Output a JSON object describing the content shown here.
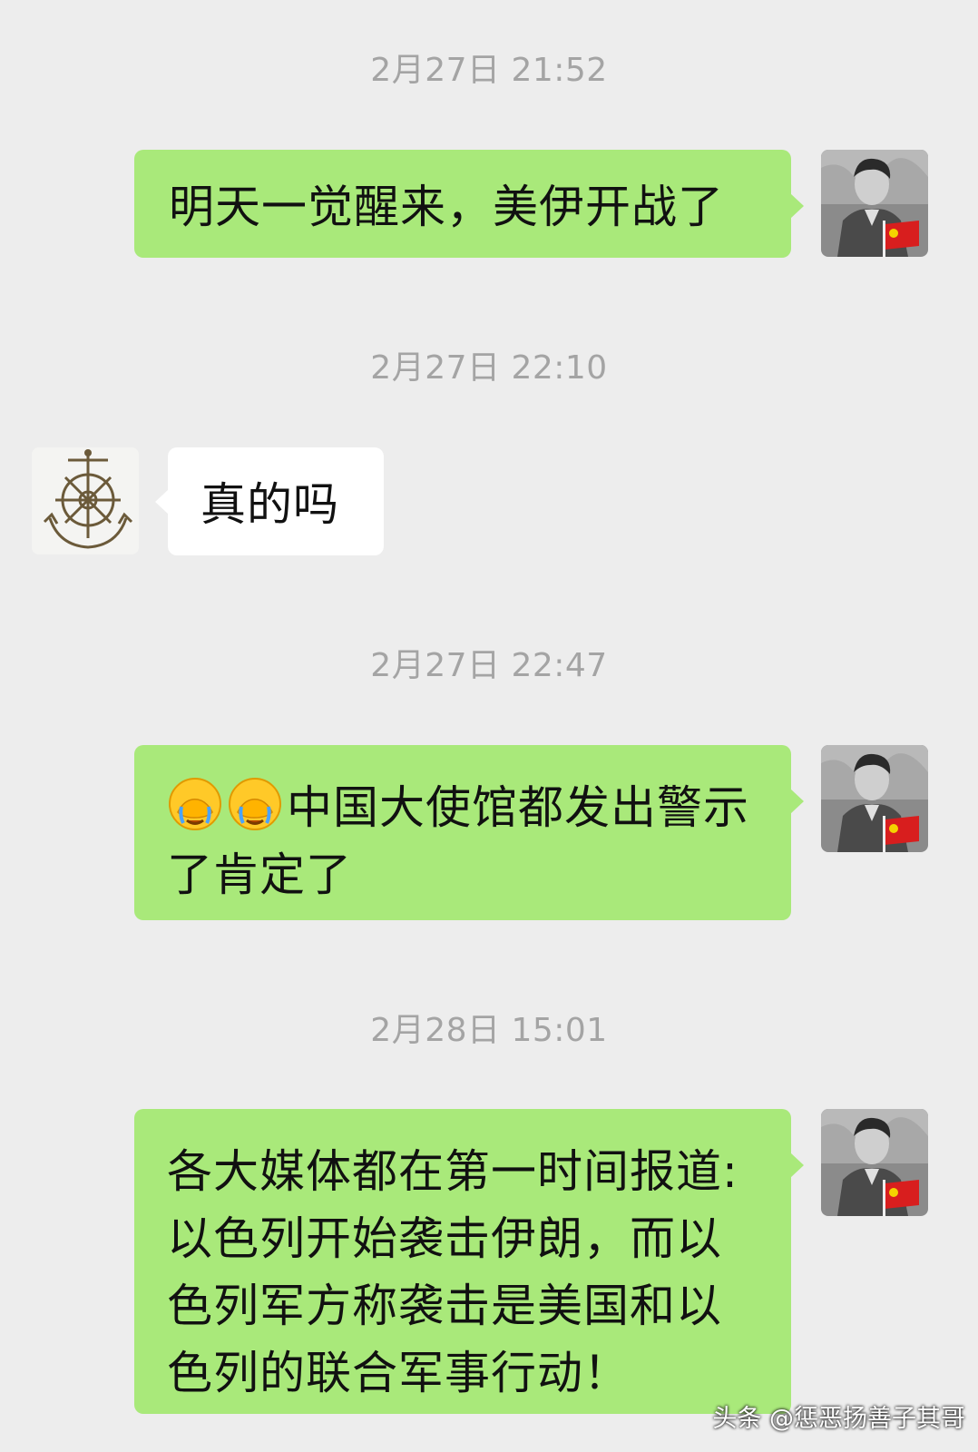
{
  "chat": {
    "messages": [
      {
        "timestamp": "2月27日 21:52",
        "sender": "me",
        "text": "明天一觉醒来，美伊开战了"
      },
      {
        "timestamp": "2月27日 22:10",
        "sender": "other",
        "text": "真的吗"
      },
      {
        "timestamp": "2月27日 22:47",
        "sender": "me",
        "emoji": [
          "face-palm-crying-emoji",
          "face-palm-crying-emoji"
        ],
        "text": "中国大使馆都发出警示了肯定了"
      },
      {
        "timestamp": "2月28日 15:01",
        "sender": "me",
        "text": "各大媒体都在第一时间报道:以色列开始袭击伊朗，而以色列军方称袭击是美国和以色列的联合军事行动！"
      }
    ]
  },
  "avatars": {
    "me": {
      "icon": "man-portrait-with-flag-avatar"
    },
    "other": {
      "icon": "ship-wheel-anchor-avatar"
    }
  },
  "watermark": {
    "text": "头条 @惩恶扬善子其哥"
  },
  "colors": {
    "background": "#ededed",
    "sent_bubble": "#a9e97a",
    "received_bubble": "#ffffff",
    "timestamp": "#a4a4a4"
  }
}
